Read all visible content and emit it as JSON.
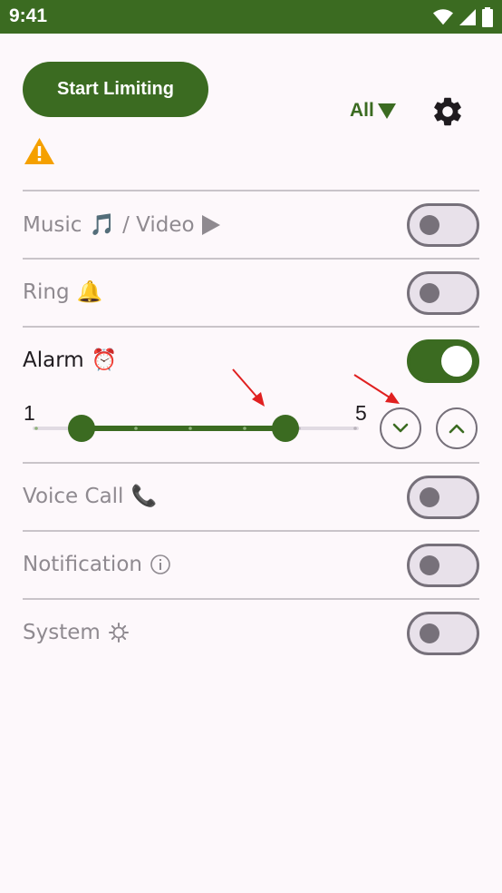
{
  "status_bar": {
    "time": "9:41"
  },
  "header": {
    "start_button_label": "Start Limiting",
    "filter_label": "All"
  },
  "rows": [
    {
      "label": "Music",
      "label_suffix": "/ Video",
      "enabled": false
    },
    {
      "label": "Ring",
      "enabled": false
    },
    {
      "label": "Alarm",
      "enabled": true
    },
    {
      "label": "Voice Call",
      "enabled": false
    },
    {
      "label": "Notification",
      "enabled": false
    },
    {
      "label": "System",
      "enabled": false
    }
  ],
  "alarm_range": {
    "min_label": "1",
    "max_label": "5",
    "range_min": 1,
    "range_max": 5,
    "steps": 6,
    "low_value": 1,
    "high_value": 4
  },
  "colors": {
    "primary": "#3b6b21",
    "warning": "#f5a000",
    "annotation_arrow": "#e02020"
  }
}
